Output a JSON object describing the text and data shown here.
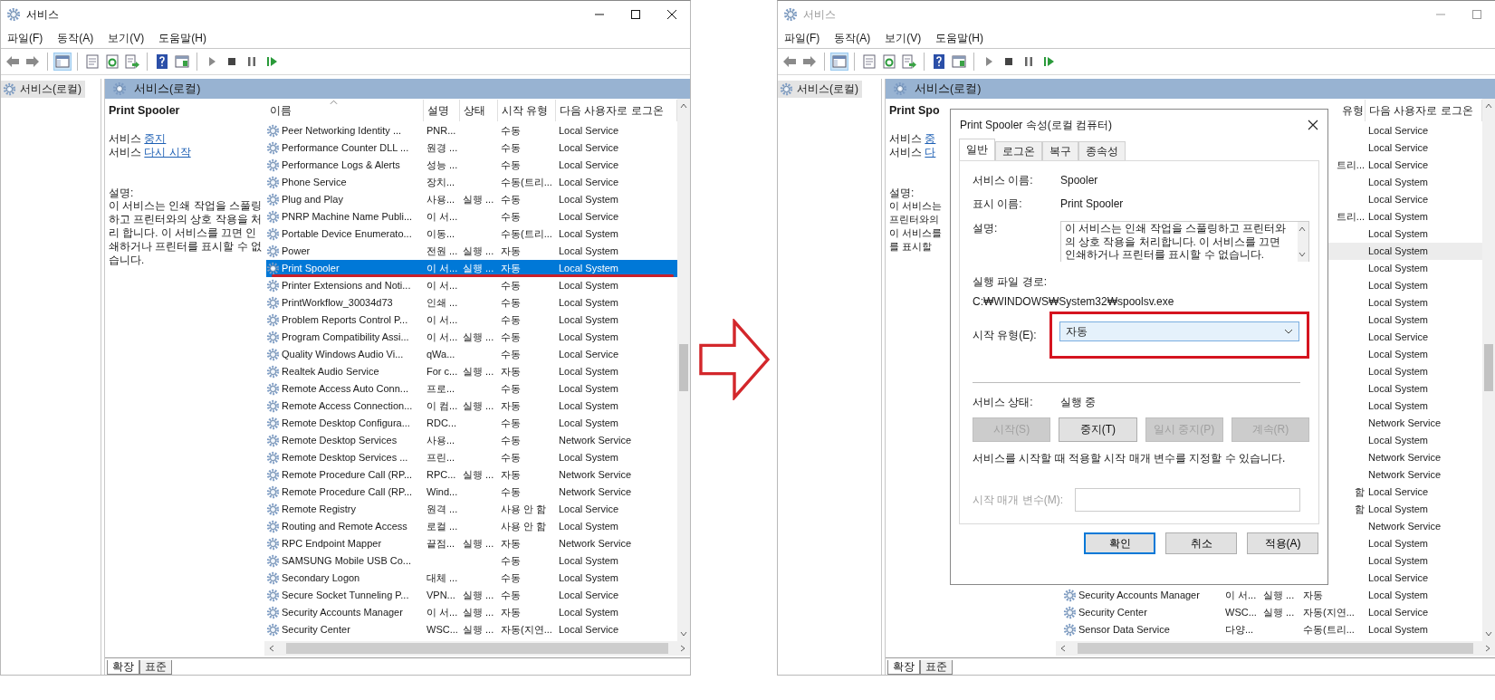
{
  "left_window": {
    "title": "서비스",
    "active": true,
    "menu": [
      "파일(F)",
      "동작(A)",
      "보기(V)",
      "도움말(H)"
    ],
    "tree_item": "서비스(로컬)",
    "header_title": "서비스(로컬)",
    "detail": [
      {
        "kind": "title",
        "text": "Print Spooler"
      },
      {
        "kind": "action",
        "prefix": "서비스 ",
        "link": "중지"
      },
      {
        "kind": "action",
        "prefix": "서비스 ",
        "link": "다시 시작"
      },
      {
        "kind": "label",
        "text": "설명:"
      },
      {
        "kind": "text",
        "text": "이 서비스는 인쇄 작업을 스풀링하고 프린터와의 상호 작용을 처리 합니다. 이 서비스를 끄면 인쇄하거나 프린터를 표시할 수 없습니다."
      }
    ],
    "columns": [
      "이름",
      "설명",
      "상태",
      "시작 유형",
      "다음 사용자로 로그온"
    ],
    "rows": [
      {
        "name": "Peer Networking Identity ...",
        "description": "PNR...",
        "status": "",
        "start_type": "수동",
        "logon": "Local Service",
        "selected": false,
        "annotated": false
      },
      {
        "name": "Performance Counter DLL ...",
        "description": "원경 ...",
        "status": "",
        "start_type": "수동",
        "logon": "Local Service",
        "selected": false,
        "annotated": false
      },
      {
        "name": "Performance Logs & Alerts",
        "description": "성능 ...",
        "status": "",
        "start_type": "수동",
        "logon": "Local Service",
        "selected": false,
        "annotated": false
      },
      {
        "name": "Phone Service",
        "description": "장치...",
        "status": "",
        "start_type": "수동(트리...",
        "logon": "Local Service",
        "selected": false,
        "annotated": false
      },
      {
        "name": "Plug and Play",
        "description": "사용...",
        "status": "실행 ...",
        "start_type": "수동",
        "logon": "Local System",
        "selected": false,
        "annotated": false
      },
      {
        "name": "PNRP Machine Name Publi...",
        "description": "이 서...",
        "status": "",
        "start_type": "수동",
        "logon": "Local Service",
        "selected": false,
        "annotated": false
      },
      {
        "name": "Portable Device Enumerato...",
        "description": "이동...",
        "status": "",
        "start_type": "수동(트리...",
        "logon": "Local System",
        "selected": false,
        "annotated": false
      },
      {
        "name": "Power",
        "description": "전원 ...",
        "status": "실행 ...",
        "start_type": "자동",
        "logon": "Local System",
        "selected": false,
        "annotated": false
      },
      {
        "name": "Print Spooler",
        "description": "이 서...",
        "status": "실행 ...",
        "start_type": "자동",
        "logon": "Local System",
        "selected": true,
        "annotated": true
      },
      {
        "name": "Printer Extensions and Noti...",
        "description": "이 서...",
        "status": "",
        "start_type": "수동",
        "logon": "Local System",
        "selected": false,
        "annotated": false
      },
      {
        "name": "PrintWorkflow_30034d73",
        "description": "인쇄 ...",
        "status": "",
        "start_type": "수동",
        "logon": "Local System",
        "selected": false,
        "annotated": false
      },
      {
        "name": "Problem Reports Control P...",
        "description": "이 서...",
        "status": "",
        "start_type": "수동",
        "logon": "Local System",
        "selected": false,
        "annotated": false
      },
      {
        "name": "Program Compatibility Assi...",
        "description": "이 서...",
        "status": "실행 ...",
        "start_type": "수동",
        "logon": "Local System",
        "selected": false,
        "annotated": false
      },
      {
        "name": "Quality Windows Audio Vi...",
        "description": "qWa...",
        "status": "",
        "start_type": "수동",
        "logon": "Local Service",
        "selected": false,
        "annotated": false
      },
      {
        "name": "Realtek Audio Service",
        "description": "For c...",
        "status": "실행 ...",
        "start_type": "자동",
        "logon": "Local System",
        "selected": false,
        "annotated": false
      },
      {
        "name": "Remote Access Auto Conn...",
        "description": "프로...",
        "status": "",
        "start_type": "수동",
        "logon": "Local System",
        "selected": false,
        "annotated": false
      },
      {
        "name": "Remote Access Connection...",
        "description": "이 컴...",
        "status": "실행 ...",
        "start_type": "자동",
        "logon": "Local System",
        "selected": false,
        "annotated": false
      },
      {
        "name": "Remote Desktop Configura...",
        "description": "RDC...",
        "status": "",
        "start_type": "수동",
        "logon": "Local System",
        "selected": false,
        "annotated": false
      },
      {
        "name": "Remote Desktop Services",
        "description": "사용...",
        "status": "",
        "start_type": "수동",
        "logon": "Network Service",
        "selected": false,
        "annotated": false
      },
      {
        "name": "Remote Desktop Services ...",
        "description": "프린...",
        "status": "",
        "start_type": "수동",
        "logon": "Local System",
        "selected": false,
        "annotated": false
      },
      {
        "name": "Remote Procedure Call (RP...",
        "description": "RPC...",
        "status": "실행 ...",
        "start_type": "자동",
        "logon": "Network Service",
        "selected": false,
        "annotated": false
      },
      {
        "name": "Remote Procedure Call (RP...",
        "description": "Wind...",
        "status": "",
        "start_type": "수동",
        "logon": "Network Service",
        "selected": false,
        "annotated": false
      },
      {
        "name": "Remote Registry",
        "description": "원격 ...",
        "status": "",
        "start_type": "사용 안 함",
        "logon": "Local Service",
        "selected": false,
        "annotated": false
      },
      {
        "name": "Routing and Remote Access",
        "description": "로컬 ...",
        "status": "",
        "start_type": "사용 안 함",
        "logon": "Local System",
        "selected": false,
        "annotated": false
      },
      {
        "name": "RPC Endpoint Mapper",
        "description": "끝점...",
        "status": "실행 ...",
        "start_type": "자동",
        "logon": "Network Service",
        "selected": false,
        "annotated": false
      },
      {
        "name": "SAMSUNG Mobile USB Co...",
        "description": "",
        "status": "",
        "start_type": "수동",
        "logon": "Local System",
        "selected": false,
        "annotated": false
      },
      {
        "name": "Secondary Logon",
        "description": "대체 ...",
        "status": "",
        "start_type": "수동",
        "logon": "Local System",
        "selected": false,
        "annotated": false
      },
      {
        "name": "Secure Socket Tunneling P...",
        "description": "VPN...",
        "status": "실행 ...",
        "start_type": "수동",
        "logon": "Local Service",
        "selected": false,
        "annotated": false
      },
      {
        "name": "Security Accounts Manager",
        "description": "이 서...",
        "status": "실행 ...",
        "start_type": "자동",
        "logon": "Local System",
        "selected": false,
        "annotated": false
      },
      {
        "name": "Security Center",
        "description": "WSC...",
        "status": "실행 ...",
        "start_type": "자동(지연...",
        "logon": "Local Service",
        "selected": false,
        "annotated": false
      }
    ],
    "bottom_tabs": [
      {
        "label": "확장",
        "selected": true
      },
      {
        "label": "표준",
        "selected": false
      }
    ]
  },
  "right_window": {
    "title": "서비스",
    "active": false,
    "menu": [
      "파일(F)",
      "동작(A)",
      "보기(V)",
      "도움말(H)"
    ],
    "tree_item": "서비스(로컬)",
    "header_title": "서비스(로컬)",
    "detail": [
      {
        "kind": "title",
        "text": "Print Spo"
      },
      {
        "kind": "action",
        "prefix": "서비스 ",
        "link": "중"
      },
      {
        "kind": "action",
        "prefix": "서비스 ",
        "link": "다"
      },
      {
        "kind": "label",
        "text": "설명:"
      },
      {
        "kind": "text",
        "text": "이 서비스는"
      },
      {
        "kind": "text",
        "text": "프린터와의"
      },
      {
        "kind": "text",
        "text": "이 서비스를"
      },
      {
        "kind": "text",
        "text": "를 표시할"
      }
    ],
    "header": {
      "start_type": "유형",
      "logon": "다음 사용자로 로그온"
    },
    "rows": [
      {
        "logon": "Local Service",
        "selected": false
      },
      {
        "logon": "Local Service",
        "selected": false
      },
      {
        "start_type": "트리...",
        "logon": "Local Service",
        "selected": false
      },
      {
        "logon": "Local System",
        "selected": false
      },
      {
        "logon": "Local Service",
        "selected": false
      },
      {
        "start_type": "트리...",
        "logon": "Local System",
        "selected": false
      },
      {
        "logon": "Local System",
        "selected": false
      },
      {
        "logon": "Local System",
        "selected": true
      },
      {
        "logon": "Local System",
        "selected": false
      },
      {
        "logon": "Local System",
        "selected": false
      },
      {
        "logon": "Local System",
        "selected": false
      },
      {
        "logon": "Local System",
        "selected": false
      },
      {
        "logon": "Local Service",
        "selected": false
      },
      {
        "logon": "Local System",
        "selected": false
      },
      {
        "logon": "Local System",
        "selected": false
      },
      {
        "logon": "Local System",
        "selected": false
      },
      {
        "logon": "Local System",
        "selected": false
      },
      {
        "logon": "Network Service",
        "selected": false
      },
      {
        "logon": "Local System",
        "selected": false
      },
      {
        "logon": "Network Service",
        "selected": false
      },
      {
        "logon": "Network Service",
        "selected": false
      },
      {
        "start_type": "함",
        "logon": "Local Service",
        "selected": false
      },
      {
        "start_type": "함",
        "logon": "Local System",
        "selected": false
      },
      {
        "logon": "Network Service",
        "selected": false
      },
      {
        "logon": "Local System",
        "selected": false
      },
      {
        "logon": "Local System",
        "selected": false
      },
      {
        "logon": "Local Service",
        "selected": false
      },
      {
        "name": "Security Accounts Manager",
        "description": "이 서...",
        "status": "실행 ...",
        "start_type": "자동",
        "logon": "Local System",
        "selected": false
      },
      {
        "name": "Security Center",
        "description": "WSC...",
        "status": "실행 ...",
        "start_type": "자동(지연...",
        "logon": "Local Service",
        "selected": false
      },
      {
        "name": "Sensor Data Service",
        "description": "다양...",
        "status": "",
        "start_type": "수동(트리...",
        "logon": "Local System",
        "selected": false
      }
    ],
    "bottom_tabs": [
      {
        "label": "확장",
        "selected": true
      },
      {
        "label": "표준",
        "selected": false
      }
    ]
  },
  "dialog": {
    "title": "Print Spooler 속성(로컬 컴퓨터)",
    "tabs": [
      {
        "label": "일반",
        "selected": true
      },
      {
        "label": "로그온",
        "selected": false
      },
      {
        "label": "복구",
        "selected": false
      },
      {
        "label": "종속성",
        "selected": false
      }
    ],
    "fields": [
      {
        "label": "서비스 이름:",
        "value": "Spooler"
      },
      {
        "label": "표시 이름:",
        "value": "Print Spooler"
      }
    ],
    "description_label": "설명:",
    "description": "이 서비스는 인쇄 작업을 스풀링하고 프린터와의 상호 작용을 처리합니다. 이 서비스를 끄면 인쇄하거나 프린터를 표시할 수 없습니다.",
    "path_label": "실행 파일 경로:",
    "path": "C:₩WINDOWS₩System32₩spoolsv.exe",
    "startup_label": "시작 유형(E):",
    "startup_value": "자동",
    "startup_annotated": true,
    "status_label": "서비스 상태:",
    "status_value": "실행 중",
    "control_buttons": [
      {
        "label": "시작(S)",
        "disabled": true
      },
      {
        "label": "중지(T)",
        "disabled": false
      },
      {
        "label": "일시 중지(P)",
        "disabled": true
      },
      {
        "label": "계속(R)",
        "disabled": true
      }
    ],
    "hint": "서비스를 시작할 때 적용할 시작 매개 변수를 지정할 수 있습니다.",
    "params_label": "시작 매개 변수(M):",
    "params_disabled": true,
    "footer_buttons": [
      {
        "label": "확인",
        "default": true
      },
      {
        "label": "취소",
        "default": false
      },
      {
        "label": "적용(A)",
        "default": false
      }
    ]
  }
}
